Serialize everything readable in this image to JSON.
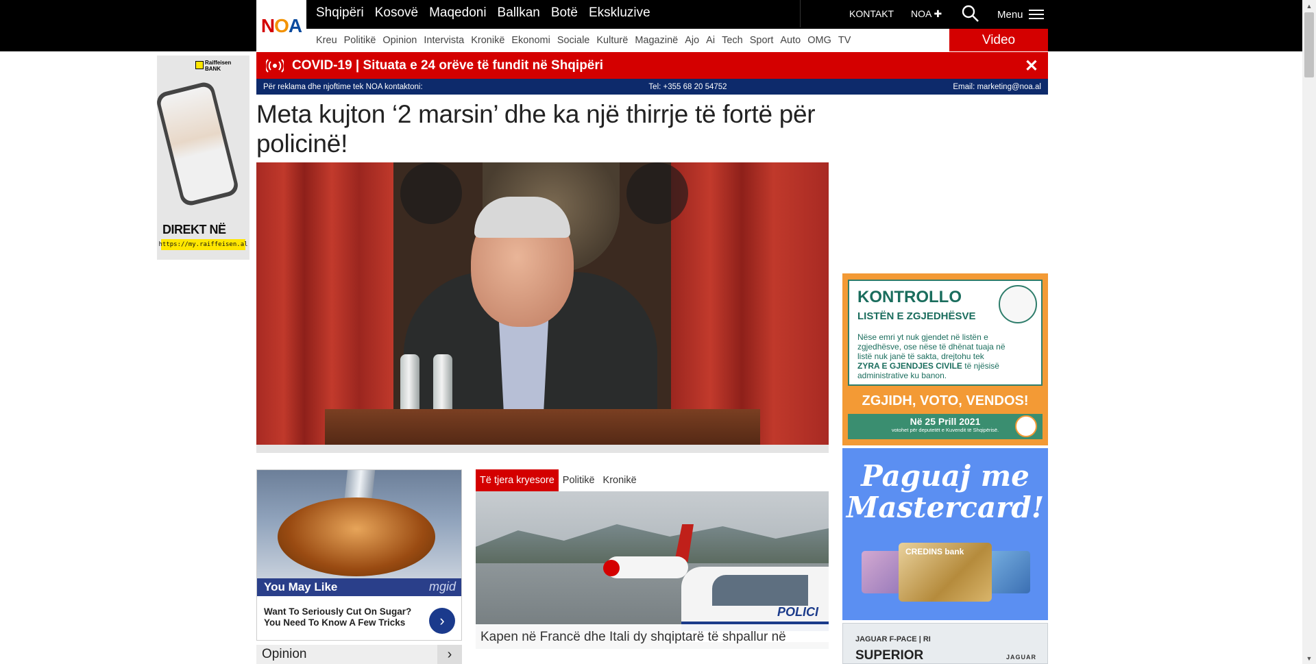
{
  "logo": {
    "text": "NOA",
    "colors": [
      "#d40000",
      "#f39200",
      "#0a4a9e"
    ]
  },
  "main_nav": [
    "Shqipëri",
    "Kosovë",
    "Maqedoni",
    "Ballkan",
    "Botë",
    "Ekskluzive"
  ],
  "top_right": {
    "kontakt": "KONTAKT",
    "noa_plus": "NOA ✚",
    "menu": "Menu"
  },
  "sub_nav": [
    "Kreu",
    "Politikë",
    "Opinion",
    "Intervista",
    "Kronikë",
    "Ekonomi",
    "Sociale",
    "Kulturë",
    "Magazinë",
    "Ajo",
    "Ai",
    "Tech",
    "Sport",
    "Auto",
    "OMG",
    "TV"
  ],
  "video_button": "Video",
  "covid_bar": {
    "text": "COVID-19 | Situata e 24 orëve të fundit në Shqipëri",
    "close": "✕"
  },
  "ad_info": {
    "left": "Për reklama dhe njoftime tek NOA kontaktoni:",
    "phone": "Tel: +355 68 20 54752",
    "email": "Email: marketing@noa.al"
  },
  "headline": "Meta kujton ‘2 marsin’ dhe ka një thirrje të fortë për policinë!",
  "left_ad": {
    "brand_line1": "Raiffeisen",
    "brand_line2": "BANK",
    "direkt": "DIREKT NË",
    "url": "https://my.raiffeisen.al"
  },
  "spoon_ad": {
    "header": "You May Like",
    "network": "mgid",
    "text": "Want To Seriously Cut On Sugar? You Need To Know A Few Tricks",
    "go": "›"
  },
  "opinion": {
    "label": "Opinion",
    "arrow": "›"
  },
  "tabs": {
    "items": [
      "Të tjera kryesore",
      "Politikë",
      "Kronikë"
    ],
    "active": 0
  },
  "article2": {
    "caption": "Kapen në Francë dhe Itali dy shqiptarë të shpallur në",
    "van_text": "POLICI"
  },
  "kz_ad": {
    "title": "KONTROLLO",
    "subtitle": "LISTËN E ZGJEDHËSVE",
    "body_pre": "Nëse emri yt nuk gjendet në listën e zgjedhësve, ose nëse të dhënat tuaja në listë nuk janë të sakta, drejtohu tek",
    "body_bold": "ZYRA E GJENDJES CIVILE",
    "body_post": "të njësisë administrative ku banon.",
    "slogan": "ZGJIDH, VOTO, VENDOS!",
    "date": "Në 25 Prill 2021",
    "date_sub": "votohet për deputetët e Kuvendit të Shqipërisë."
  },
  "mc_ad": {
    "slogan_line1": "Paguaj me",
    "slogan_line2": "Mastercard!",
    "card_brand": "CREDINS bank"
  },
  "jag_ad": {
    "line1": "JAGUAR F-PACE | RI",
    "line2": "SUPERIOR",
    "brand": "JAGUAR"
  },
  "icons": {
    "search": "search-icon",
    "menu": "hamburger-icon",
    "live": "broadcast-icon",
    "close": "close-icon"
  }
}
